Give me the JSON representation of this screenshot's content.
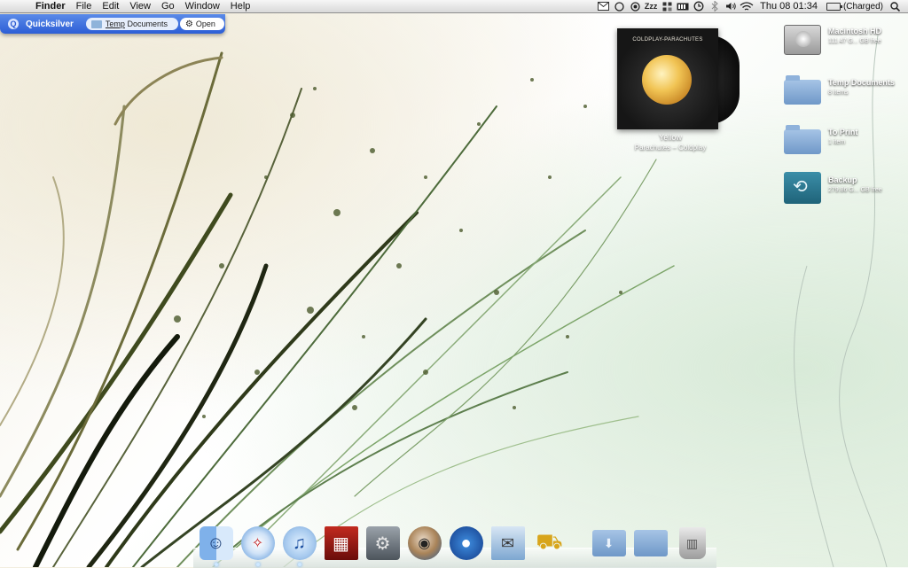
{
  "menubar": {
    "apple_glyph": "",
    "app_name": "Finder",
    "menus": [
      "File",
      "Edit",
      "View",
      "Go",
      "Window",
      "Help"
    ],
    "status_icons": [
      "mail-icon",
      "circle-icon",
      "target-icon",
      "sleep-icon",
      "menu-extra-icon",
      "battery-bar-icon",
      "time-machine-icon",
      "bluetooth-icon",
      "volume-icon",
      "wifi-icon"
    ],
    "sleep_label": "Zzz",
    "clock": "Thu 08 01:34",
    "battery_status": "(Charged)"
  },
  "quicksilver": {
    "title": "Quicksilver",
    "object_underlined": "Temp",
    "object_rest": "Documents",
    "action": "Open"
  },
  "now_playing": {
    "album_cover_text": "COLDPLAY-PARACHUTES",
    "track": "Yellow",
    "album_artist": "Parachutes – Coldplay"
  },
  "desktop_icons": [
    {
      "name": "Macintosh HD",
      "info": "111.47 G... GB free",
      "icon": "hard-drive-icon"
    },
    {
      "name": "Temp Documents",
      "info": "8 items",
      "icon": "folder-icon"
    },
    {
      "name": "To Print",
      "info": "1 item",
      "icon": "folder-icon"
    },
    {
      "name": "Backup",
      "info": "279.86 G... GB free",
      "icon": "time-machine-drive-icon"
    }
  ],
  "dock": {
    "items": [
      {
        "label": "Finder",
        "icon": "finder-icon",
        "glyph": "☺",
        "running": true
      },
      {
        "label": "Safari",
        "icon": "safari-icon",
        "glyph": "✧",
        "running": true
      },
      {
        "label": "iTunes",
        "icon": "itunes-icon",
        "glyph": "♫",
        "running": true
      },
      {
        "label": "Front Row",
        "icon": "front-row-icon",
        "glyph": "▦",
        "running": false
      },
      {
        "label": "System Preferences",
        "icon": "gear-icon",
        "glyph": "⚙",
        "running": false
      },
      {
        "label": "Camino",
        "icon": "camino-icon",
        "glyph": "◉",
        "running": false
      },
      {
        "label": "Adium",
        "icon": "adium-duck-icon",
        "glyph": "●",
        "running": false
      },
      {
        "label": "Mail",
        "icon": "mail-stamp-icon",
        "glyph": "✉",
        "running": false
      },
      {
        "label": "Transmit",
        "icon": "transmit-truck-icon",
        "glyph": "⛟",
        "running": false
      }
    ],
    "stacks": [
      {
        "label": "Downloads",
        "icon": "downloads-folder-icon",
        "glyph": "⬇"
      },
      {
        "label": "Documents",
        "icon": "documents-folder-icon",
        "glyph": ""
      },
      {
        "label": "Trash",
        "icon": "trash-icon",
        "glyph": "▥"
      }
    ]
  }
}
